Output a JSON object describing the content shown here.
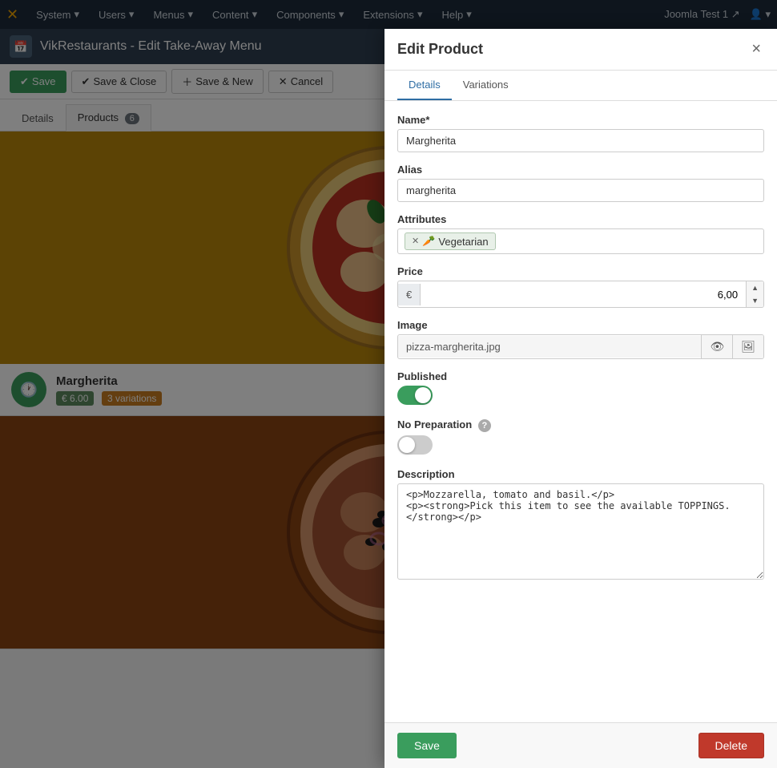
{
  "topnav": {
    "logo": "✕",
    "items": [
      {
        "label": "System",
        "id": "system"
      },
      {
        "label": "Users",
        "id": "users"
      },
      {
        "label": "Menus",
        "id": "menus"
      },
      {
        "label": "Content",
        "id": "content"
      },
      {
        "label": "Components",
        "id": "components"
      },
      {
        "label": "Extensions",
        "id": "extensions"
      },
      {
        "label": "Help",
        "id": "help"
      }
    ],
    "site_label": "Joomla Test 1 ↗",
    "user_icon": "👤"
  },
  "subheader": {
    "icon": "📅",
    "title": "VikRestaurants - Edit Take-Away Menu"
  },
  "toolbar": {
    "save_label": "Save",
    "save_close_label": "Save & Close",
    "save_new_label": "Save & New",
    "cancel_label": "Cancel"
  },
  "page_tabs": [
    {
      "label": "Details",
      "id": "details",
      "active": true
    },
    {
      "label": "Products",
      "id": "products",
      "badge": "6"
    }
  ],
  "products": [
    {
      "name": "Margherita",
      "price": "€ 6.00",
      "variations": "3 variations",
      "icon": "🕐"
    }
  ],
  "modal": {
    "title": "Edit Product",
    "close_icon": "×",
    "tabs": [
      {
        "label": "Details",
        "active": true
      },
      {
        "label": "Variations",
        "active": false
      }
    ],
    "form": {
      "name_label": "Name*",
      "name_value": "Margherita",
      "alias_label": "Alias",
      "alias_value": "margherita",
      "attributes_label": "Attributes",
      "attribute_tag": "Vegetarian",
      "attribute_icon": "🥕",
      "price_label": "Price",
      "price_currency": "€",
      "price_value": "6,00",
      "image_label": "Image",
      "image_value": "pizza-margherita.jpg",
      "published_label": "Published",
      "published_on": true,
      "no_preparation_label": "No Preparation",
      "no_preparation_on": false,
      "description_label": "Description",
      "description_value": "<p>Mozzarella, tomato and basil.</p>\n<p><strong>Pick this item to see the available TOPPINGS.</strong></p>"
    },
    "footer": {
      "save_label": "Save",
      "delete_label": "Delete"
    }
  }
}
